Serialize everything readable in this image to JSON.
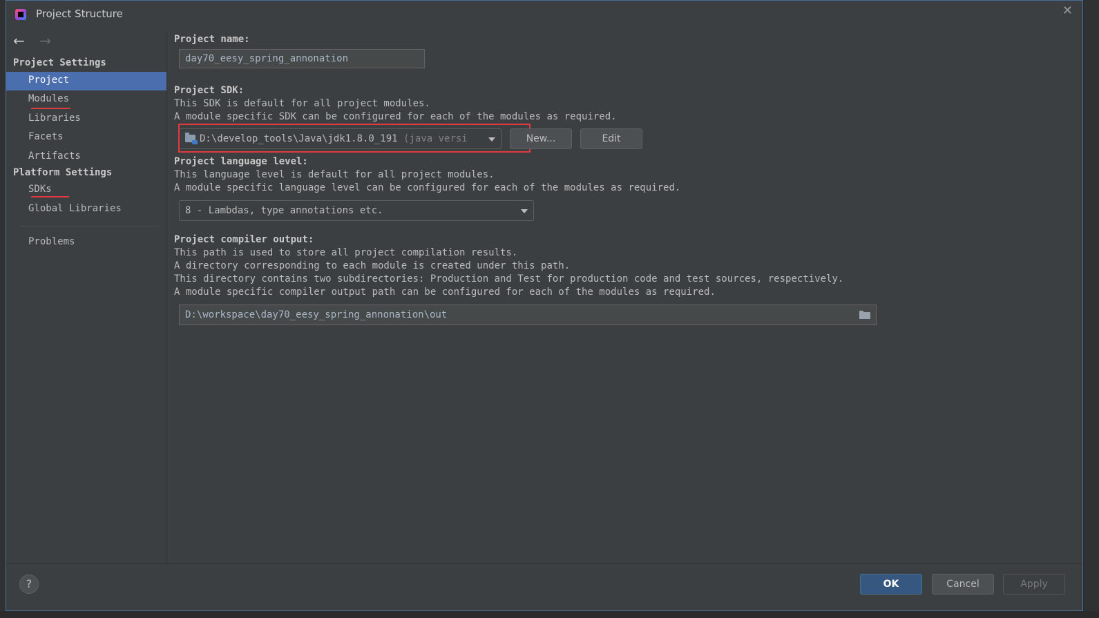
{
  "window": {
    "title": "Project Structure",
    "close_glyph": "✕"
  },
  "nav": {
    "back_glyph": "←",
    "forward_glyph": "→"
  },
  "sidebar": {
    "project_settings_header": "Project Settings",
    "platform_settings_header": "Platform Settings",
    "items": {
      "project": "Project",
      "modules": "Modules",
      "libraries": "Libraries",
      "facets": "Facets",
      "artifacts": "Artifacts",
      "sdks": "SDKs",
      "global_libraries": "Global Libraries",
      "problems": "Problems"
    },
    "selected": "Project"
  },
  "project_name": {
    "label": "Project name:",
    "value": "day70_eesy_spring_annonation"
  },
  "project_sdk": {
    "label": "Project SDK:",
    "desc_1": "This SDK is default for all project modules.",
    "desc_2": "A module specific SDK can be configured for each of the modules as required.",
    "selected_path": "D:\\develop_tools\\Java\\jdk1.8.0_191",
    "selected_version": "(java versi",
    "new_button": "New...",
    "edit_button": "Edit"
  },
  "language_level": {
    "label": "Project language level:",
    "desc_1": "This language level is default for all project modules.",
    "desc_2": "A module specific language level can be configured for each of the modules as required.",
    "selected": "8 - Lambdas, type annotations etc."
  },
  "compiler_output": {
    "label": "Project compiler output:",
    "desc_1": "This path is used to store all project compilation results.",
    "desc_2": "A directory corresponding to each module is created under this path.",
    "desc_3": "This directory contains two subdirectories: Production and Test for production code and test sources, respectively.",
    "desc_4": "A module specific compiler output path can be configured for each of the modules as required.",
    "path": "D:\\workspace\\day70_eesy_spring_annonation\\out"
  },
  "footer": {
    "help": "?",
    "ok": "OK",
    "cancel": "Cancel",
    "apply": "Apply"
  },
  "colors": {
    "background": "#3c3f41",
    "selection": "#4b6eaf",
    "annotation_red": "#e0393e",
    "primary_button": "#365880"
  }
}
